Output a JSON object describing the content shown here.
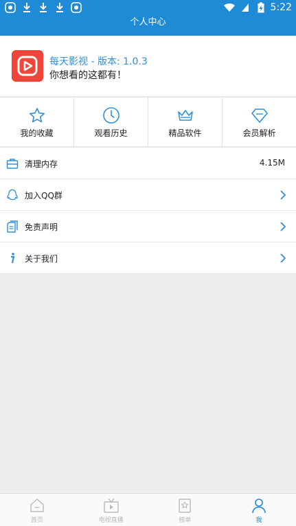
{
  "status_bar": {
    "time": "5:22",
    "left_icons": [
      "app-icon",
      "download-icon",
      "download-icon",
      "download-icon",
      "app-icon"
    ],
    "right_icons": [
      "wifi-icon",
      "signal-icon",
      "battery-charging-icon"
    ]
  },
  "header": {
    "title": "个人中心"
  },
  "profile": {
    "app_name": "每天影视 - 版本: 1.0.3",
    "slogan": "你想看的这都有！",
    "logo_icon": "play-logo-icon"
  },
  "shortcuts": [
    {
      "label": "我的收藏",
      "icon": "star-icon"
    },
    {
      "label": "观看历史",
      "icon": "clock-icon"
    },
    {
      "label": "精品软件",
      "icon": "crown-icon"
    },
    {
      "label": "会员解析",
      "icon": "diamond-icon"
    }
  ],
  "settings": [
    {
      "label": "清理内存",
      "icon": "toolbox-icon",
      "value": "4.15M"
    },
    {
      "label": "加入QQ群",
      "icon": "qq-icon"
    },
    {
      "label": "免责声明",
      "icon": "document-icon"
    },
    {
      "label": "关于我们",
      "icon": "info-icon"
    }
  ],
  "tabs": [
    {
      "label": "首页",
      "icon": "home-icon",
      "active": false
    },
    {
      "label": "电视直播",
      "icon": "tv-icon",
      "active": false
    },
    {
      "label": "榜单",
      "icon": "ranking-icon",
      "active": false
    },
    {
      "label": "我",
      "icon": "user-icon",
      "active": true
    }
  ],
  "colors": {
    "accent": "#1f8ad6",
    "logo": "#f0453a",
    "tab_inactive": "#b9b9b9"
  }
}
